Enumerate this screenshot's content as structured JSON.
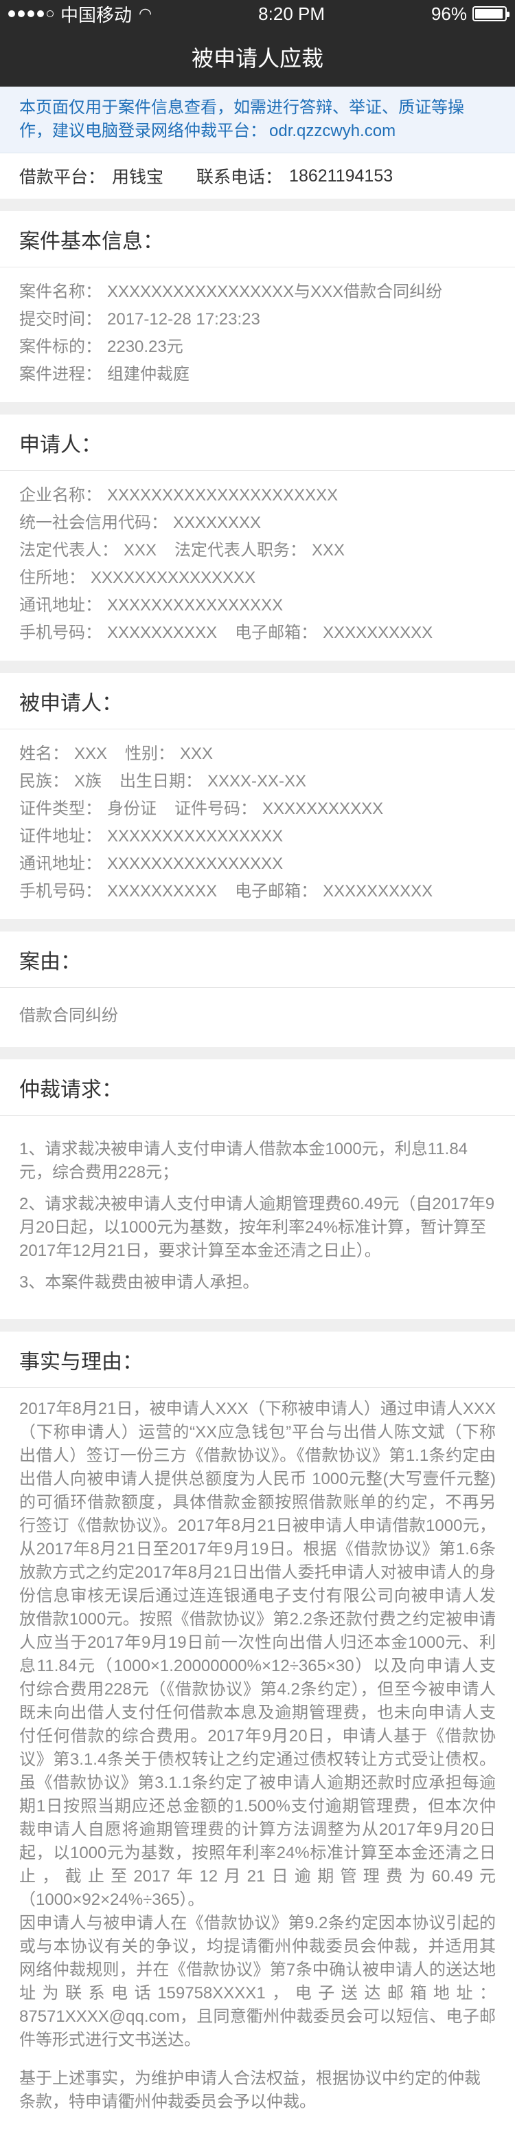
{
  "status": {
    "carrier": "中国移动",
    "time": "8:20 PM",
    "battery": "96%",
    "battery_level": 0.96,
    "signal_bars": 4
  },
  "nav": {
    "title": "被申请人应裁"
  },
  "notice": {
    "text": "本页面仅用于案件信息查看，如需进行答辩、举证、质证等操作，建议电脑登录网络仲裁平台：",
    "url": "odr.qzzcwyh.com"
  },
  "platform": {
    "platform_label": "借款平台：",
    "platform_value": "用钱宝",
    "phone_label": "联系电话：",
    "phone_value": "18621194153"
  },
  "case_info": {
    "title": "案件基本信息：",
    "name_label": "案件名称：",
    "name_value": "XXXXXXXXXXXXXXXXX与XXX借款合同纠纷",
    "time_label": "提交时间：",
    "time_value": "2017-12-28 17:23:23",
    "amount_label": "案件标的：",
    "amount_value": "2230.23元",
    "progress_label": "案件进程：",
    "progress_value": "组建仲裁庭"
  },
  "applicant": {
    "title": "申请人：",
    "company_label": "企业名称：",
    "company_value": "XXXXXXXXXXXXXXXXXXXXX",
    "credit_label": "统一社会信用代码：",
    "credit_value": "XXXXXXXX",
    "rep_label": "法定代表人：",
    "rep_value": "XXX",
    "rep_title_label": "法定代表人职务：",
    "rep_title_value": "XXX",
    "address_label": "住所地：",
    "address_value": "XXXXXXXXXXXXXXX",
    "mail_label": "通讯地址：",
    "mail_value": "XXXXXXXXXXXXXXXX",
    "mobile_label": "手机号码：",
    "mobile_value": "XXXXXXXXXX",
    "email_label": "电子邮箱：",
    "email_value": "XXXXXXXXXX"
  },
  "respondent": {
    "title": "被申请人：",
    "name_label": "姓名：",
    "name_value": "XXX",
    "gender_label": "性别：",
    "gender_value": "XXX",
    "ethnic_label": "民族：",
    "ethnic_value": "X族",
    "birth_label": "出生日期：",
    "birth_value": "XXXX-XX-XX",
    "idtype_label": "证件类型：",
    "idtype_value": "身份证",
    "idno_label": "证件号码：",
    "idno_value": "XXXXXXXXXXX",
    "idaddr_label": "证件地址：",
    "idaddr_value": "XXXXXXXXXXXXXXXX",
    "mail_label": "通讯地址：",
    "mail_value": "XXXXXXXXXXXXXXXX",
    "mobile_label": "手机号码：",
    "mobile_value": "XXXXXXXXXX",
    "email_label": "电子邮箱：",
    "email_value": "XXXXXXXXXX"
  },
  "cause": {
    "title": "案由：",
    "value": "借款合同纠纷"
  },
  "claims": {
    "title": "仲裁请求：",
    "items": [
      "1、请求裁决被申请人支付申请人借款本金1000元，利息11.84元，综合费用228元；",
      "2、请求裁决被申请人支付申请人逾期管理费60.49元（自2017年9月20日起，以1000元为基数，按年利率24%标准计算，暂计算至2017年12月21日，要求计算至本金还清之日止）。",
      "3、本案件裁费由被申请人承担。"
    ]
  },
  "facts": {
    "title": "事实与理由：",
    "body": "2017年8月21日，被申请人XXX（下称被申请人）通过申请人XXX（下称申请人）运营的“XX应急钱包”平台与出借人陈文斌（下称出借人）签订一份三方《借款协议》。《借款协议》第1.1条约定由出借人向被申请人提供总额度为人民币 1000元整(大写壹仟元整)的可循环借款额度，具体借款金额按照借款账单的约定，不再另行签订《借款协议》。2017年8月21日被申请人申请借款1000元，从2017年8月21日至2017年9月19日。根据《借款协议》第1.6条放款方式之约定2017年8月21日出借人委托申请人对被申请人的身份信息审核无误后通过连连银通电子支付有限公司向被申请人发放借款1000元。按照《借款协议》第2.2条还款付费之约定被申请人应当于2017年9月19日前一次性向出借人归还本金1000元、利息11.84元（1000×1.20000000%×12÷365×30）以及向申请人支付综合费用228元（《借款协议》第4.2条约定），但至今被申请人既未向出借人支付任何借款本息及逾期管理费，也未向申请人支付任何借款的综合费用。2017年9月20日，申请人基于《借款协议》第3.1.4条关于债权转让之约定通过债权转让方式受让债权。虽《借款协议》第3.1.1条约定了被申请人逾期还款时应承担每逾期1日按照当期应还总金额的1.500%支付逾期管理费，但本次仲裁申请人自愿将逾期管理费的计算方法调整为从2017年9月20日起，以1000元为基数，按照年利率24%标准计算至本金还清之日止，截止至2017年12月21日逾期管理费为60.49元（1000×92×24%÷365）。\n因申请人与被申请人在《借款协议》第9.2条约定因本协议引起的或与本协议有关的争议，均提请衢州仲裁委员会仲裁，并适用其网络仲裁规则，并在《借款协议》第7条中确认被申请人的送达地址为联系电话159758XXXX1，电子送达邮箱地址：87571XXXX@qq.com，且同意衢州仲裁委员会可以短信、电子邮件等形式进行文书送达。",
    "conclusion": "基于上述事实，为维护申请人合法权益，根据协议中约定的仲裁条款，特申请衢州仲裁委员会予以仲裁。"
  }
}
